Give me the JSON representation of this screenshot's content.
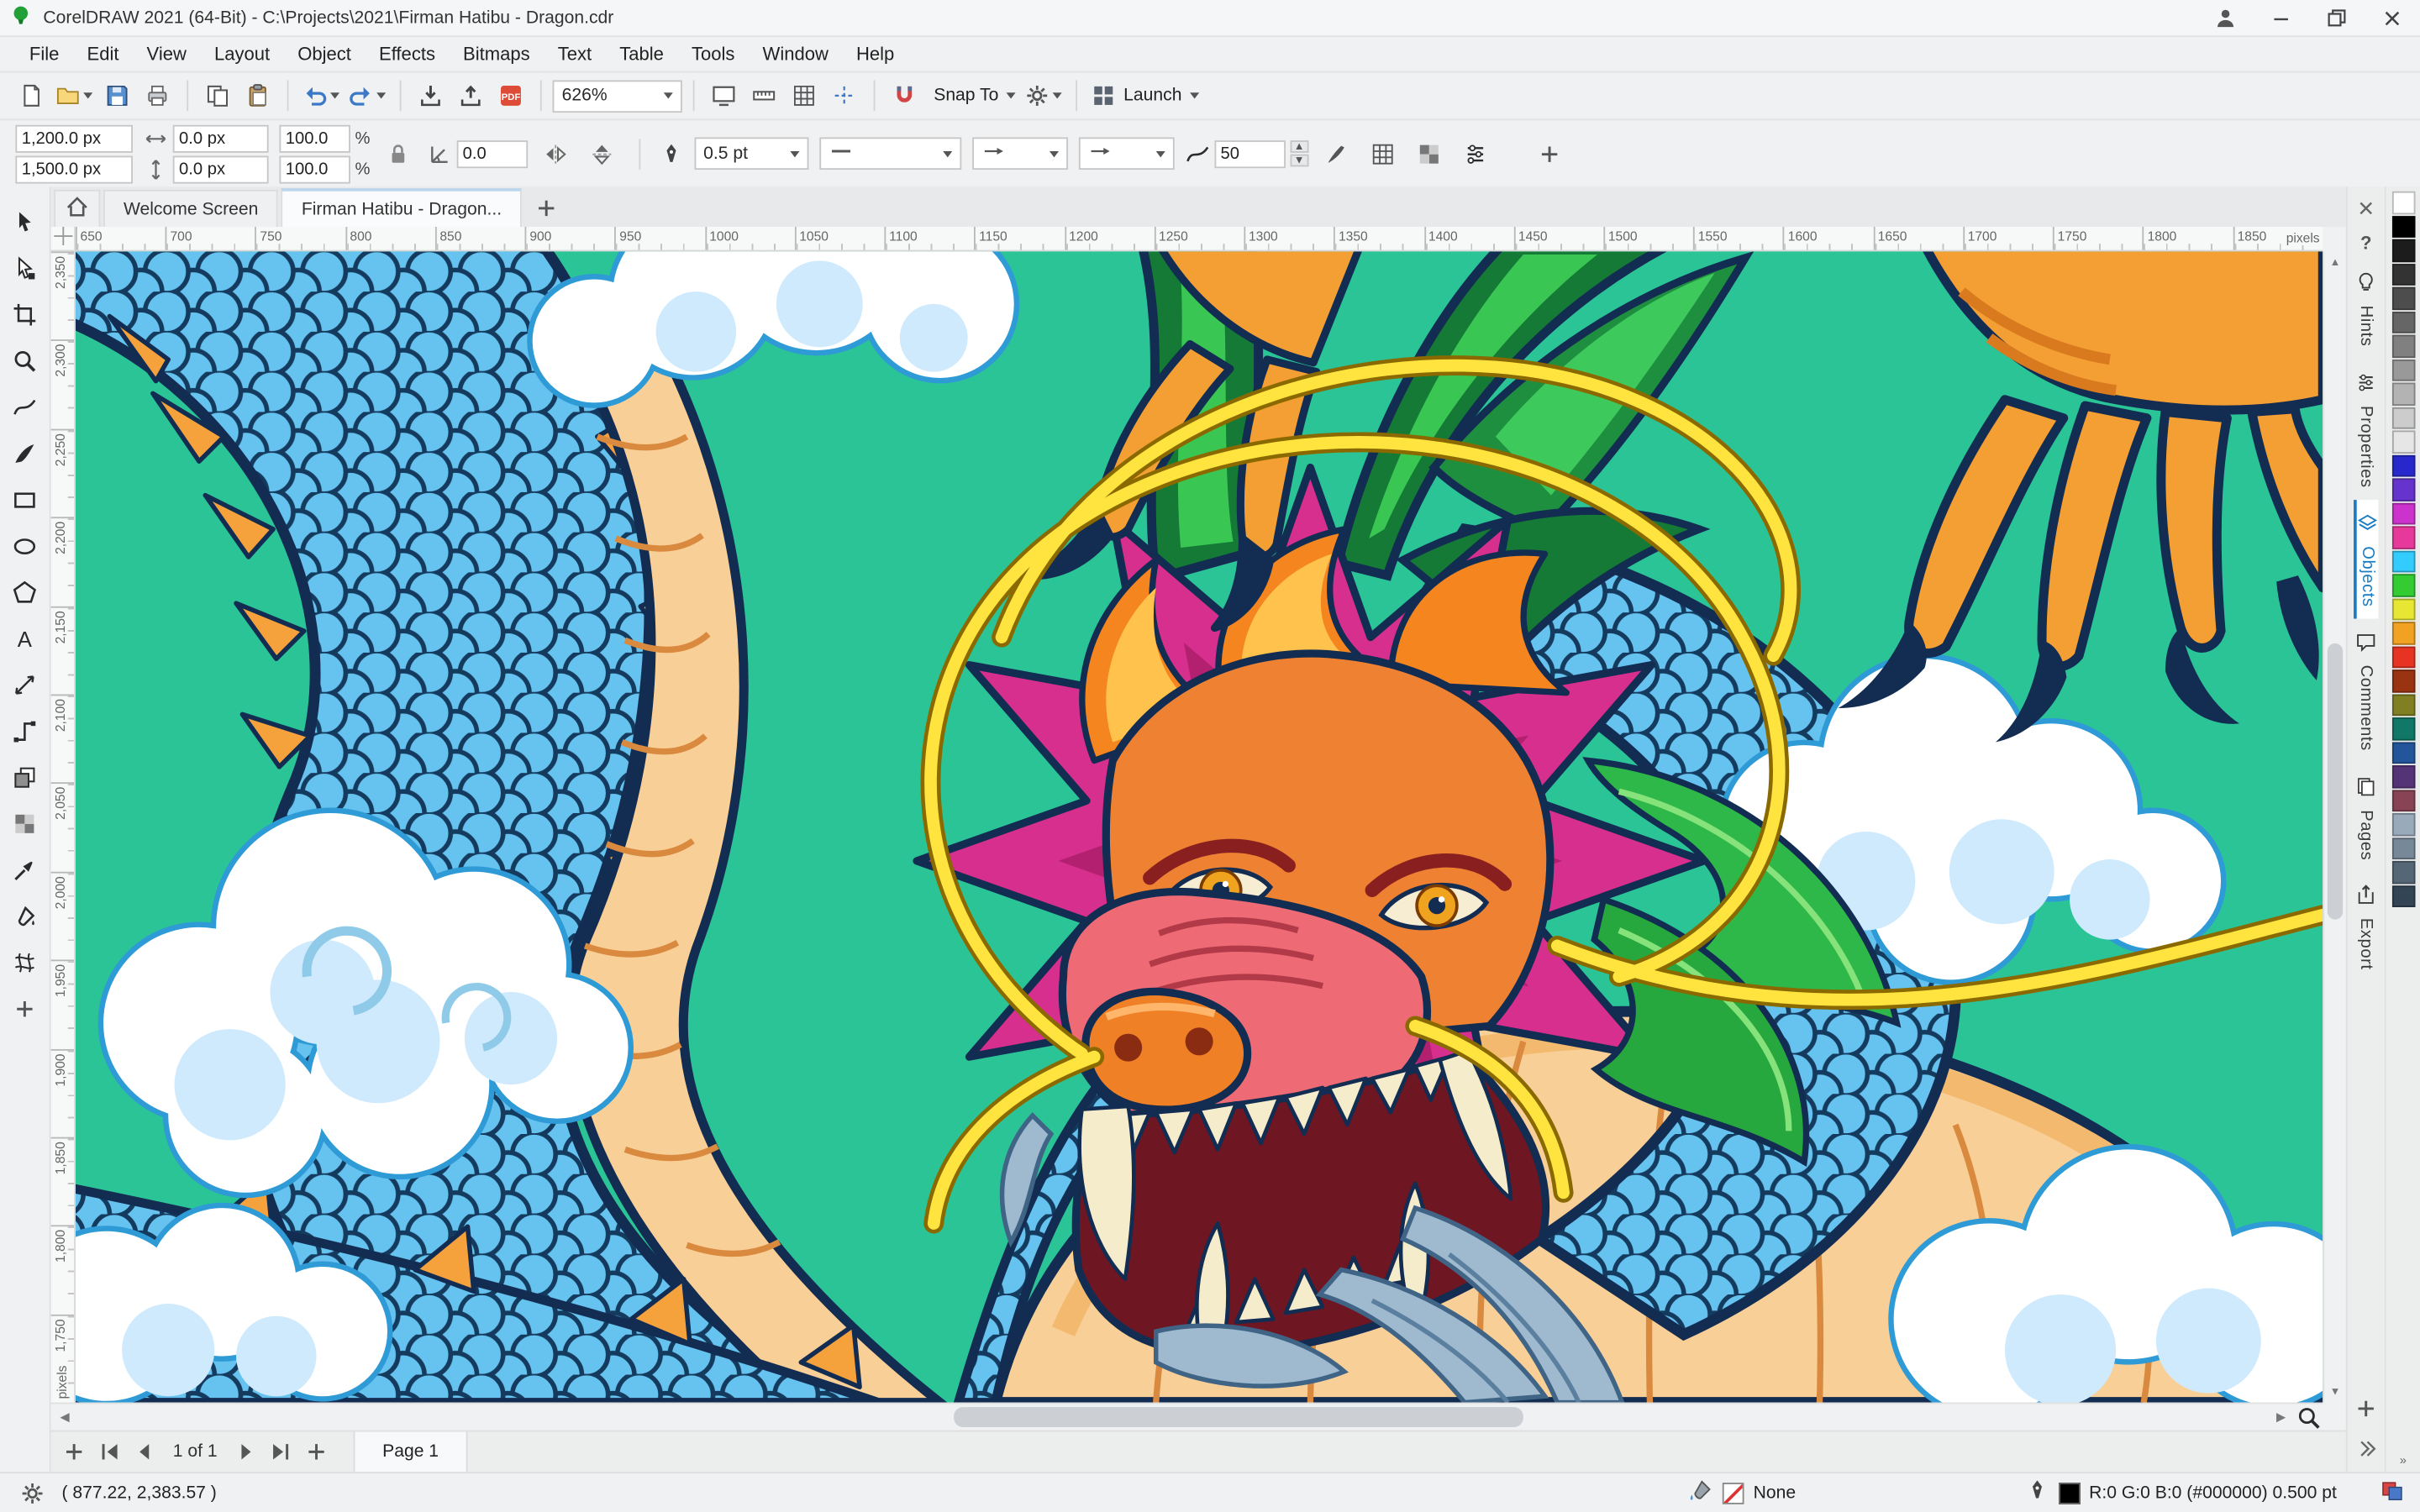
{
  "window": {
    "title": "CorelDRAW 2021 (64-Bit) - C:\\Projects\\2021\\Firman Hatibu - Dragon.cdr"
  },
  "menu": {
    "items": [
      "File",
      "Edit",
      "View",
      "Layout",
      "Object",
      "Effects",
      "Bitmaps",
      "Text",
      "Table",
      "Tools",
      "Window",
      "Help"
    ]
  },
  "toolbar": {
    "zoom_level": "626%",
    "snap_label": "Snap To",
    "launch_label": "Launch",
    "buttons": [
      {
        "t": "b",
        "i": "newdoc",
        "n": "new-document-button"
      },
      {
        "t": "b",
        "i": "open",
        "n": "open-button",
        "dd": true
      },
      {
        "t": "b",
        "i": "save",
        "n": "save-button"
      },
      {
        "t": "b",
        "i": "print",
        "n": "print-button"
      },
      {
        "t": "s"
      },
      {
        "t": "b",
        "i": "copy",
        "n": "copy-button"
      },
      {
        "t": "b",
        "i": "paste",
        "n": "paste-button"
      },
      {
        "t": "s"
      },
      {
        "t": "b",
        "i": "undo",
        "n": "undo-button",
        "dd": true
      },
      {
        "t": "b",
        "i": "redo",
        "n": "redo-button",
        "dd": true
      },
      {
        "t": "s"
      },
      {
        "t": "b",
        "i": "importi",
        "n": "import-button"
      },
      {
        "t": "b",
        "i": "exporti",
        "n": "export-button"
      },
      {
        "t": "b",
        "i": "pdf",
        "n": "publish-pdf-button"
      },
      {
        "t": "s"
      },
      {
        "t": "zoom"
      },
      {
        "t": "s"
      },
      {
        "t": "b",
        "i": "fullscreen",
        "n": "fullscreen-preview-button"
      },
      {
        "t": "b",
        "i": "rulers",
        "n": "show-rulers-button"
      },
      {
        "t": "b",
        "i": "grid",
        "n": "show-grid-button"
      },
      {
        "t": "b",
        "i": "guidelines",
        "n": "show-guidelines-button"
      },
      {
        "t": "s"
      },
      {
        "t": "b",
        "i": "snapoff",
        "n": "snap-disable-button"
      },
      {
        "t": "snap"
      },
      {
        "t": "b",
        "i": "gear",
        "n": "options-button",
        "dd": true
      },
      {
        "t": "s"
      },
      {
        "t": "launch"
      }
    ]
  },
  "property_bar": {
    "pos_x": "1,200.0 px",
    "pos_y": "1,500.0 px",
    "size_w": "0.0 px",
    "size_h": "0.0 px",
    "scale_x": "100.0",
    "scale_y": "100.0",
    "percent": "%",
    "angle": "0.0",
    "outline_width": "0.5 pt",
    "treat_value": "50"
  },
  "document_tabs": {
    "welcome": "Welcome Screen",
    "active": "Firman Hatibu - Dragon..."
  },
  "rulers": {
    "unit": "pixels",
    "horizontal": [
      650,
      700,
      750,
      800,
      850,
      900,
      950,
      1000,
      1050,
      1100,
      1150,
      1200,
      1250,
      1300,
      1350,
      1400,
      1450,
      1500,
      1550,
      1600,
      1650,
      1700,
      1750,
      1800,
      1850
    ],
    "vertical": [
      2350,
      2300,
      2250,
      2200,
      2150,
      2100,
      2050,
      2000,
      1950,
      1900,
      1850,
      1800,
      1750
    ]
  },
  "toolbox": {
    "tools": [
      {
        "id": "pick",
        "icon": "pick"
      },
      {
        "id": "shape",
        "icon": "shape"
      },
      {
        "id": "crop",
        "icon": "crop"
      },
      {
        "id": "zoom",
        "icon": "zoomt"
      },
      {
        "id": "freehand",
        "icon": "freehand"
      },
      {
        "id": "artistic-media",
        "icon": "artistic"
      },
      {
        "id": "rectangle",
        "icon": "rect"
      },
      {
        "id": "ellipse",
        "icon": "ellipset"
      },
      {
        "id": "polygon",
        "icon": "polygon"
      },
      {
        "id": "text",
        "icon": "textt"
      },
      {
        "id": "parallel-dimension",
        "icon": "dimension"
      },
      {
        "id": "connector",
        "icon": "connector"
      },
      {
        "id": "drop-shadow",
        "icon": "shadow"
      },
      {
        "id": "transparency",
        "icon": "transparency"
      },
      {
        "id": "color-eyedropper",
        "icon": "dropper"
      },
      {
        "id": "interactive-fill",
        "icon": "fillt"
      },
      {
        "id": "mesh-fill",
        "icon": "mesh"
      }
    ]
  },
  "dockers": {
    "tabs": [
      {
        "id": "hints",
        "label": "Hints",
        "icon": "hints",
        "active": false
      },
      {
        "id": "properties",
        "label": "Properties",
        "icon": "propsic",
        "active": false
      },
      {
        "id": "objects",
        "label": "Objects",
        "icon": "layers",
        "active": true
      },
      {
        "id": "comments",
        "label": "Comments",
        "icon": "comment",
        "active": false
      },
      {
        "id": "pages",
        "label": "Pages",
        "icon": "pagesic",
        "active": false
      },
      {
        "id": "export",
        "label": "Export",
        "icon": "exportic",
        "active": false
      }
    ]
  },
  "palette": {
    "colors": [
      "#ffffff",
      "#000000",
      "#1c1c1c",
      "#333333",
      "#4d4d4d",
      "#666666",
      "#808080",
      "#999999",
      "#b3b3b3",
      "#cccccc",
      "#e6e6e6",
      "#2727cc",
      "#6633cc",
      "#cc33cc",
      "#e6399b",
      "#33ccff",
      "#33cc33",
      "#e6e633",
      "#f2a222",
      "#e63322",
      "#993311",
      "#808022",
      "#117766",
      "#225599",
      "#553377",
      "#884455",
      "#99aabb",
      "#778899",
      "#556677",
      "#334455"
    ]
  },
  "navigation": {
    "page_indicator": "1 of 1",
    "page_tab": "Page 1"
  },
  "status": {
    "coordinates": "( 877.22, 2,383.57 )",
    "fill_value": "None",
    "outline_value": "R:0 G:0 B:0 (#000000)  0.500 pt"
  }
}
